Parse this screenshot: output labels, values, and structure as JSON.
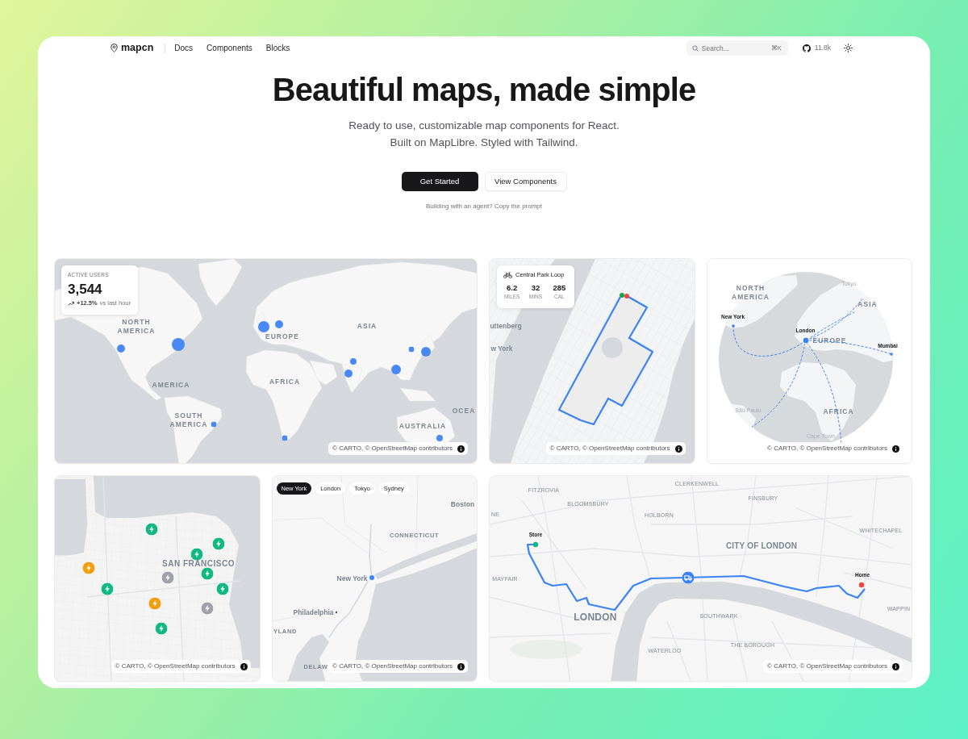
{
  "header": {
    "logo": "mapcn",
    "nav": [
      {
        "label": "Docs"
      },
      {
        "label": "Components"
      },
      {
        "label": "Blocks"
      }
    ],
    "search": {
      "placeholder": "Search...",
      "shortcut": "⌘K"
    },
    "github_stars": "11.8k"
  },
  "hero": {
    "title": "Beautiful maps, made simple",
    "subtitle_lines": [
      "Ready to use, customizable map components for React.",
      "Built on MapLibre. Styled with Tailwind."
    ],
    "buttons": [
      {
        "label": "Get Started",
        "kind": "primary"
      },
      {
        "label": "View Components",
        "kind": "secondary"
      }
    ],
    "note": "Building with an agent? Copy the prompt"
  },
  "maps": [
    {
      "kind": "world",
      "stat_card": {
        "label": "ACTIVE USERS",
        "value": "3,544",
        "change": "+12.5%",
        "change_note": "vs last hour"
      },
      "labels": [
        {
          "text": "NORTH AMERICA",
          "kind": "region"
        },
        {
          "text": "EUROPE",
          "kind": "region"
        },
        {
          "text": "ASIA",
          "kind": "region"
        },
        {
          "text": "AMERICA",
          "kind": "region"
        },
        {
          "text": "AFRICA",
          "kind": "region"
        },
        {
          "text": "SOUTH AMERICA",
          "kind": "region"
        },
        {
          "text": "OCEA",
          "kind": "region"
        },
        {
          "text": "AUSTRALIA",
          "kind": "region"
        }
      ],
      "attribution": "© CARTO, © OpenStreetMap contributors"
    },
    {
      "kind": "route",
      "route_card": {
        "title": "Central Park Loop",
        "stats": [
          {
            "value": "6.2",
            "unit": "MILES"
          },
          {
            "value": "32",
            "unit": "MINS"
          },
          {
            "value": "285",
            "unit": "CAL"
          }
        ]
      },
      "labels": [
        {
          "text": "uttenberg",
          "kind": "town"
        },
        {
          "text": "w York",
          "kind": "town"
        }
      ],
      "attribution": "© CARTO, © OpenStreetMap contributors"
    },
    {
      "kind": "globe",
      "labels": [
        {
          "text": "Tokyo",
          "kind": "faint"
        },
        {
          "text": "NORTH AMERICA",
          "kind": "region"
        },
        {
          "text": "ASIA",
          "kind": "region"
        },
        {
          "text": "New York",
          "kind": "city"
        },
        {
          "text": "London",
          "kind": "city"
        },
        {
          "text": "EUROPE",
          "kind": "region"
        },
        {
          "text": "Mumbai",
          "kind": "city"
        },
        {
          "text": "AFRICA",
          "kind": "region"
        },
        {
          "text": "São Paulo",
          "kind": "faint"
        },
        {
          "text": "Cape Town",
          "kind": "faint"
        }
      ],
      "attribution": "© CARTO, © OpenStreetMap contributors"
    },
    {
      "kind": "stations",
      "labels": [
        {
          "text": "SAN FRANCISCO",
          "kind": "region"
        }
      ],
      "stations": [
        {
          "color": "#10b981"
        },
        {
          "color": "#10b981"
        },
        {
          "color": "#10b981"
        },
        {
          "color": "#f59e0b"
        },
        {
          "color": "#10b981"
        },
        {
          "color": "#a1a1aa"
        },
        {
          "color": "#10b981"
        },
        {
          "color": "#10b981"
        },
        {
          "color": "#f59e0b"
        },
        {
          "color": "#a1a1aa"
        },
        {
          "color": "#10b981"
        }
      ],
      "attribution": "© CARTO, © OpenStreetMap contributors"
    },
    {
      "kind": "cities",
      "tabs": [
        {
          "label": "New York",
          "selected": true
        },
        {
          "label": "London",
          "selected": false
        },
        {
          "label": "Tokyo",
          "selected": false
        },
        {
          "label": "Sydney",
          "selected": false
        }
      ],
      "labels": [
        {
          "text": "Boston",
          "kind": "town"
        },
        {
          "text": "CONNECTICUT",
          "kind": "region"
        },
        {
          "text": "New York",
          "kind": "town"
        },
        {
          "text": "Philadelphia",
          "kind": "town"
        },
        {
          "text": "YLAND",
          "kind": "region"
        },
        {
          "text": "DELAW",
          "kind": "region"
        }
      ],
      "attribution": "© CARTO, © OpenStreetMap contributors"
    },
    {
      "kind": "delivery",
      "labels": [
        {
          "text": "CLERKENWELL",
          "kind": "district"
        },
        {
          "text": "FITZROVIA",
          "kind": "district"
        },
        {
          "text": "FINSBURY",
          "kind": "district"
        },
        {
          "text": "BLOOMSBURY",
          "kind": "district"
        },
        {
          "text": "NE",
          "kind": "district"
        },
        {
          "text": "HOLBORN",
          "kind": "district"
        },
        {
          "text": "WHITECHAPEL",
          "kind": "district"
        },
        {
          "text": "Store",
          "kind": "city"
        },
        {
          "text": "CITY OF LONDON",
          "kind": "region"
        },
        {
          "text": "Home",
          "kind": "city"
        },
        {
          "text": "MAYFAIR",
          "kind": "district"
        },
        {
          "text": "LONDON",
          "kind": "region"
        },
        {
          "text": "WAPPIN",
          "kind": "district"
        },
        {
          "text": "SOUTHWARK",
          "kind": "district"
        },
        {
          "text": "THE BOROUGH",
          "kind": "district"
        },
        {
          "text": "WATERLOO",
          "kind": "district"
        }
      ],
      "attribution": "© CARTO, © OpenStreetMap contributors"
    }
  ]
}
